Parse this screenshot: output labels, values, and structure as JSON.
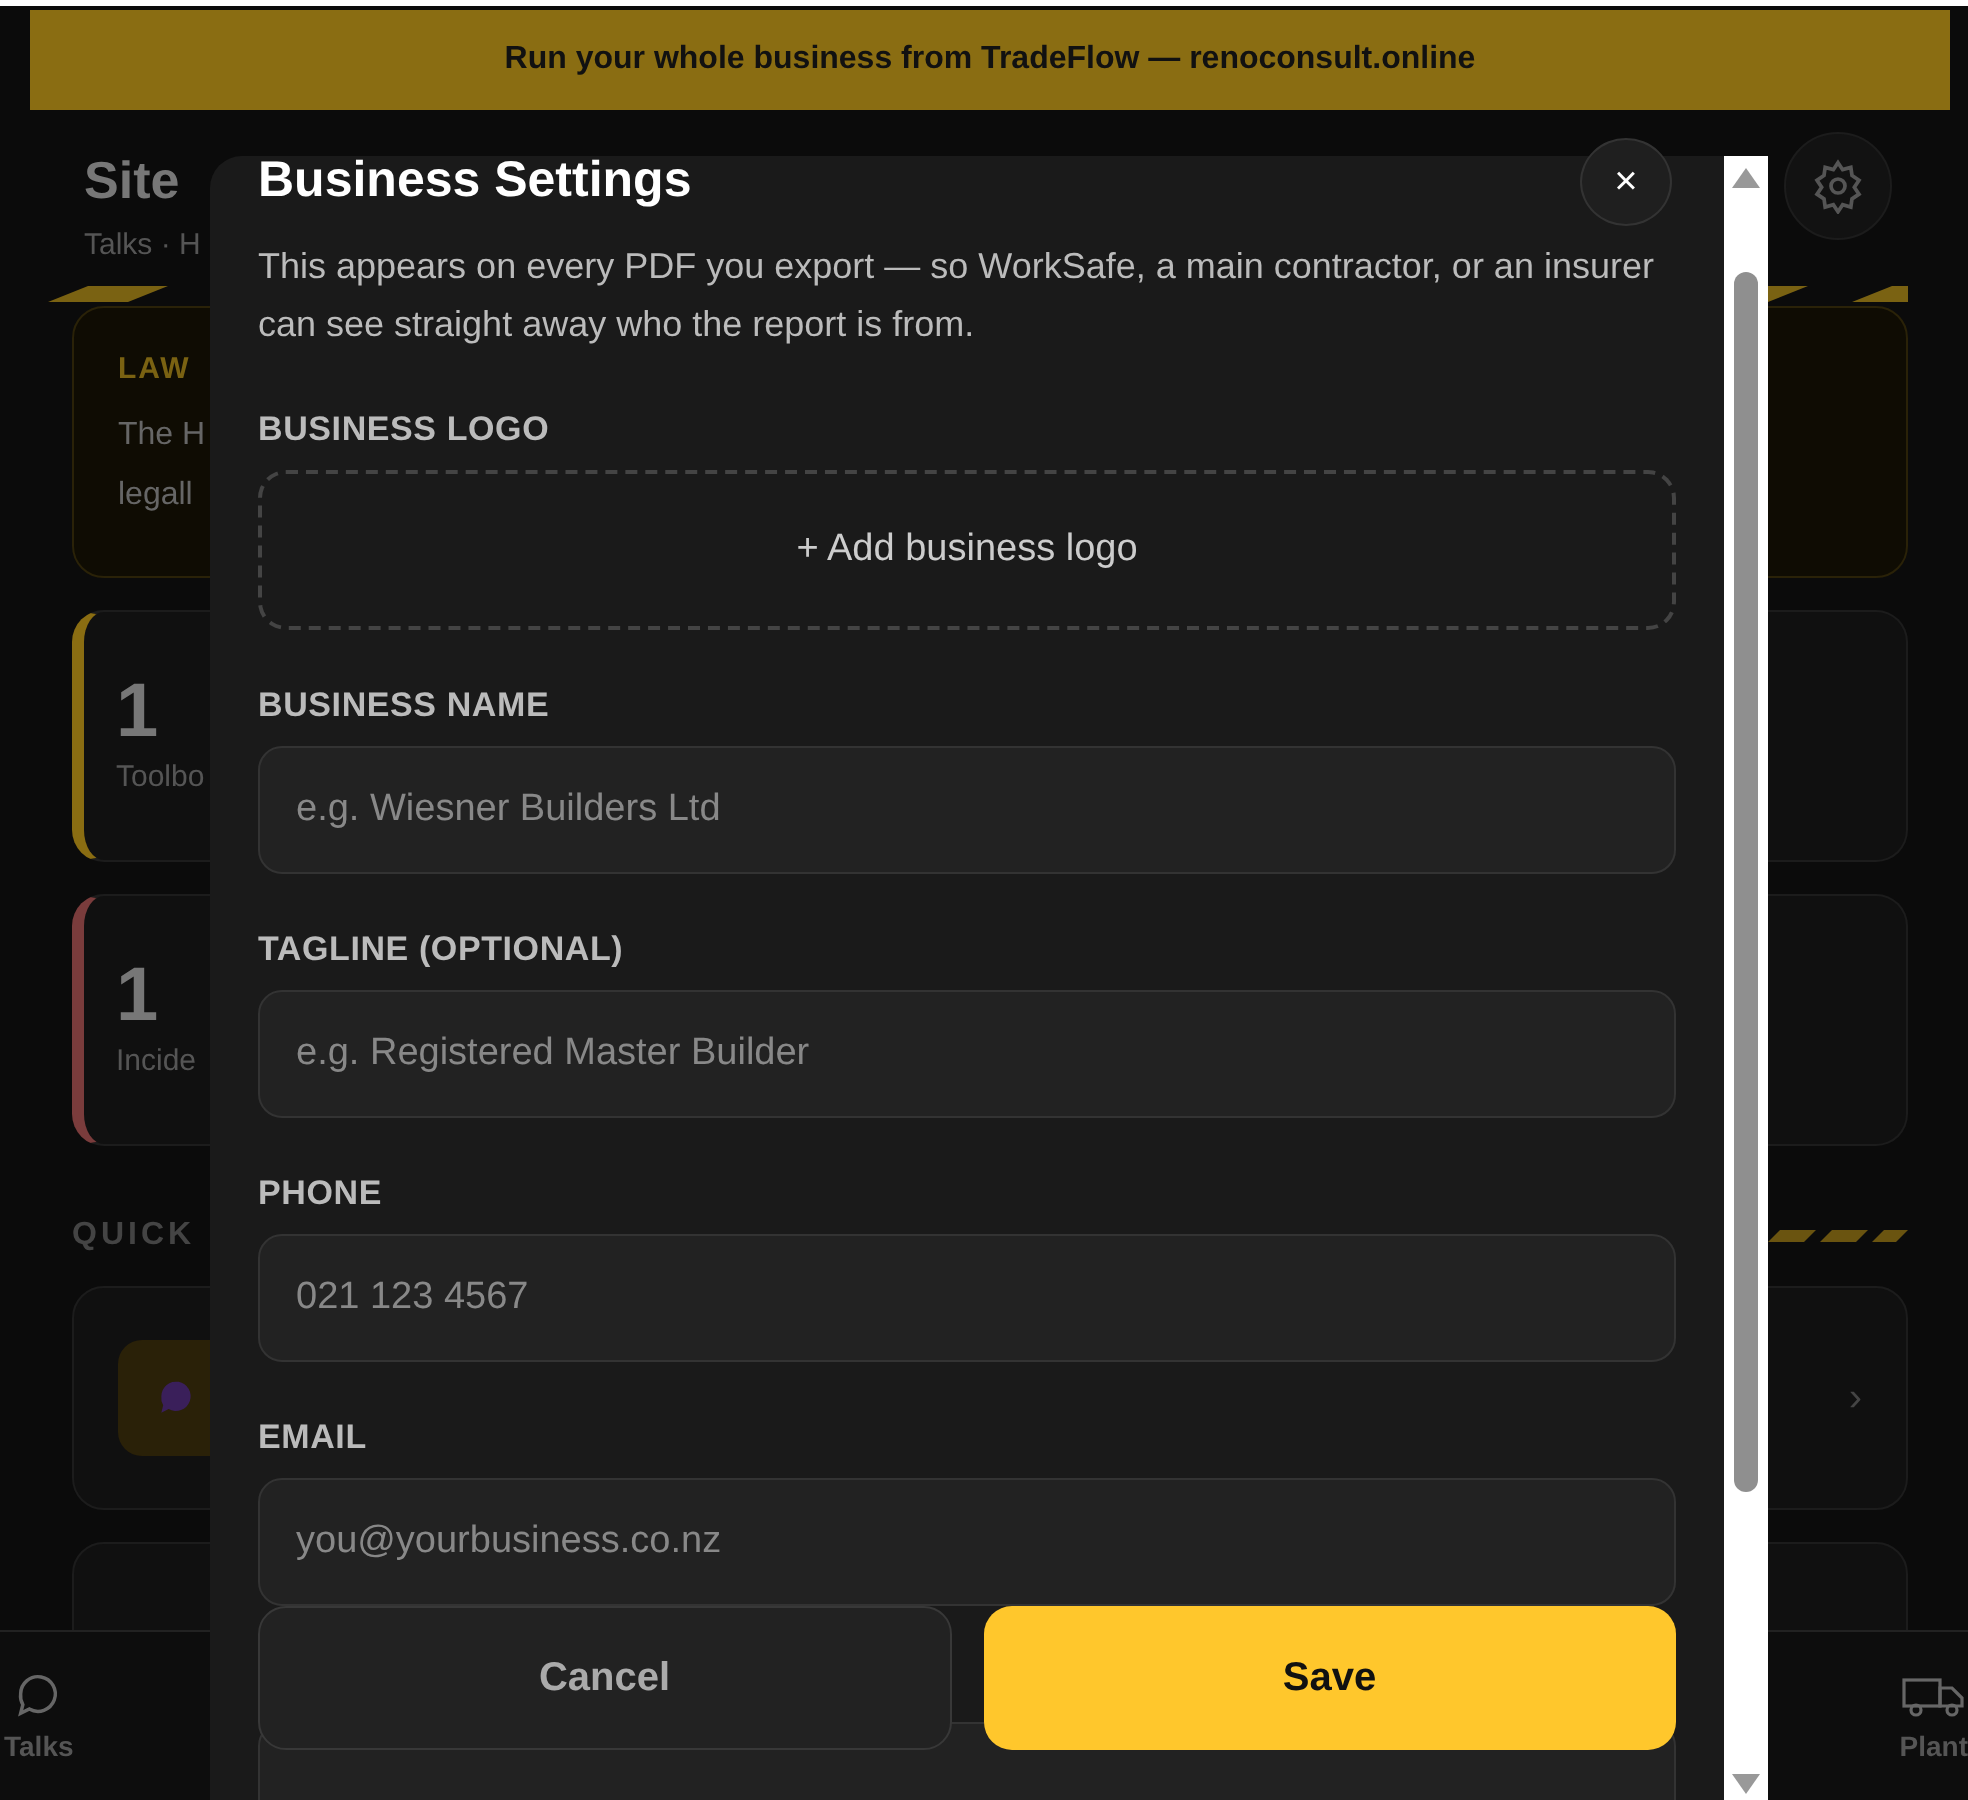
{
  "banner": {
    "text": "Run your whole business from TradeFlow — renoconsult.online"
  },
  "page": {
    "title": "Site",
    "subtitle": "Talks · H",
    "law_card": {
      "label": "LAW",
      "lines": [
        "The H",
        "legall"
      ]
    },
    "stats": [
      {
        "value": "1",
        "label": "Toolbo",
        "color": "#8a6d12"
      },
      {
        "value": "1",
        "label": "Incide",
        "color": "#7a3c3c"
      }
    ],
    "section_title": "QUICK",
    "quick_items": [
      {
        "chevron": "›"
      }
    ]
  },
  "nav": [
    {
      "label": "Talks",
      "kind": "chat"
    },
    {
      "label": "Plant",
      "kind": "truck"
    }
  ],
  "modal": {
    "title": "Business Settings",
    "close": "×",
    "description": "This appears on every PDF you export — so WorkSafe, a main contractor, or an insurer can see straight away who the report is from.",
    "logo": {
      "label": "BUSINESS LOGO",
      "button": "+ Add business logo"
    },
    "fields": [
      {
        "label": "BUSINESS NAME",
        "placeholder": "e.g. Wiesner Builders Ltd"
      },
      {
        "label": "TAGLINE (OPTIONAL)",
        "placeholder": "e.g. Registered Master Builder"
      },
      {
        "label": "PHONE",
        "placeholder": "021 123 4567"
      },
      {
        "label": "EMAIL",
        "placeholder": "you@yourbusiness.co.nz"
      }
    ],
    "buttons": [
      {
        "label": "Cancel",
        "kind": "secondary"
      },
      {
        "label": "Save",
        "kind": "primary"
      }
    ]
  }
}
